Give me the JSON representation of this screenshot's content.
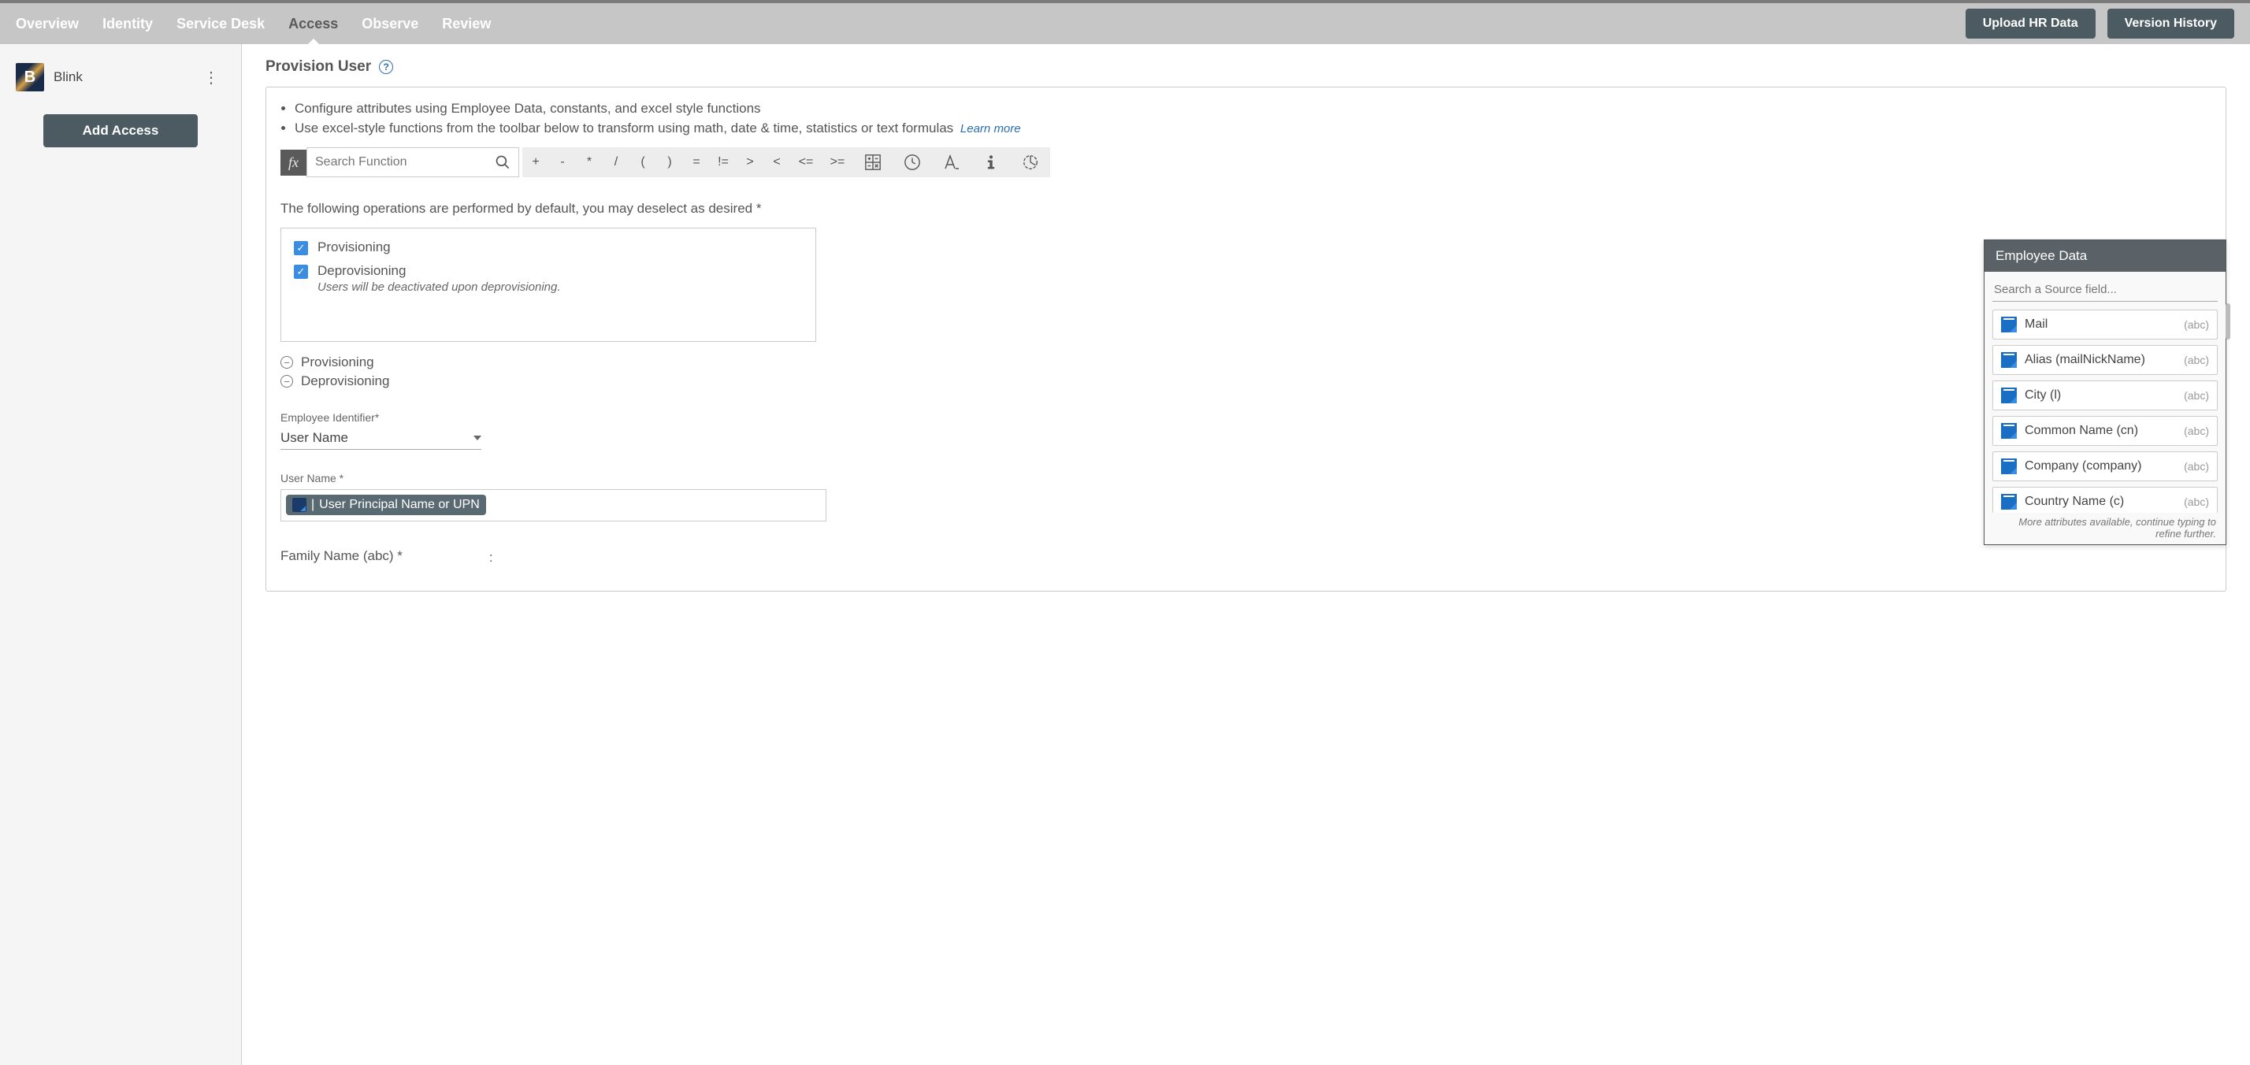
{
  "top_tabs": {
    "overview": "Overview",
    "identity": "Identity",
    "service_desk": "Service Desk",
    "access": "Access",
    "observe": "Observe",
    "review": "Review"
  },
  "top_buttons": {
    "upload": "Upload HR Data",
    "version": "Version History"
  },
  "sidebar": {
    "app_name": "Blink",
    "add_access": "Add Access"
  },
  "page": {
    "title": "Provision User",
    "bullets": {
      "b1": "Configure attributes using Employee Data, constants, and excel style functions",
      "b2": "Use excel-style functions from the toolbar below to transform using math, date & time, statistics or text formulas"
    },
    "learn_more": "Learn more",
    "fx_label": "fx",
    "search_placeholder": "Search Function",
    "ops": {
      "plus": "+",
      "minus": "-",
      "mult": "*",
      "div": "/",
      "lparen": "(",
      "rparen": ")",
      "eq": "=",
      "neq": "!=",
      "gt": ">",
      "lt": "<",
      "lte": "<=",
      "gte": ">="
    },
    "ops_desc": "The following operations are performed by default, you may deselect as desired *",
    "checkboxes": {
      "provisioning": "Provisioning",
      "deprovisioning": "Deprovisioning",
      "deprov_note": "Users will be deactivated upon deprovisioning."
    },
    "collapse": {
      "provisioning": "Provisioning",
      "deprovisioning": "Deprovisioning"
    },
    "employee_identifier_label": "Employee Identifier*",
    "employee_identifier_value": "User Name",
    "user_name_label": "User Name *",
    "user_name_chip": "User Principal Name or UPN",
    "family_name_label": "Family Name (abc) *",
    "family_name_colon": ":"
  },
  "emp_panel": {
    "title": "Employee Data",
    "search_placeholder": "Search a Source field...",
    "type_abc": "(abc)",
    "items": {
      "mail": "Mail",
      "alias": "Alias (mailNickName)",
      "city": "City (l)",
      "cn": "Common Name (cn)",
      "company": "Company (company)",
      "country": "Country Name (c)"
    },
    "footer": "More attributes available, continue typing to refine further."
  }
}
